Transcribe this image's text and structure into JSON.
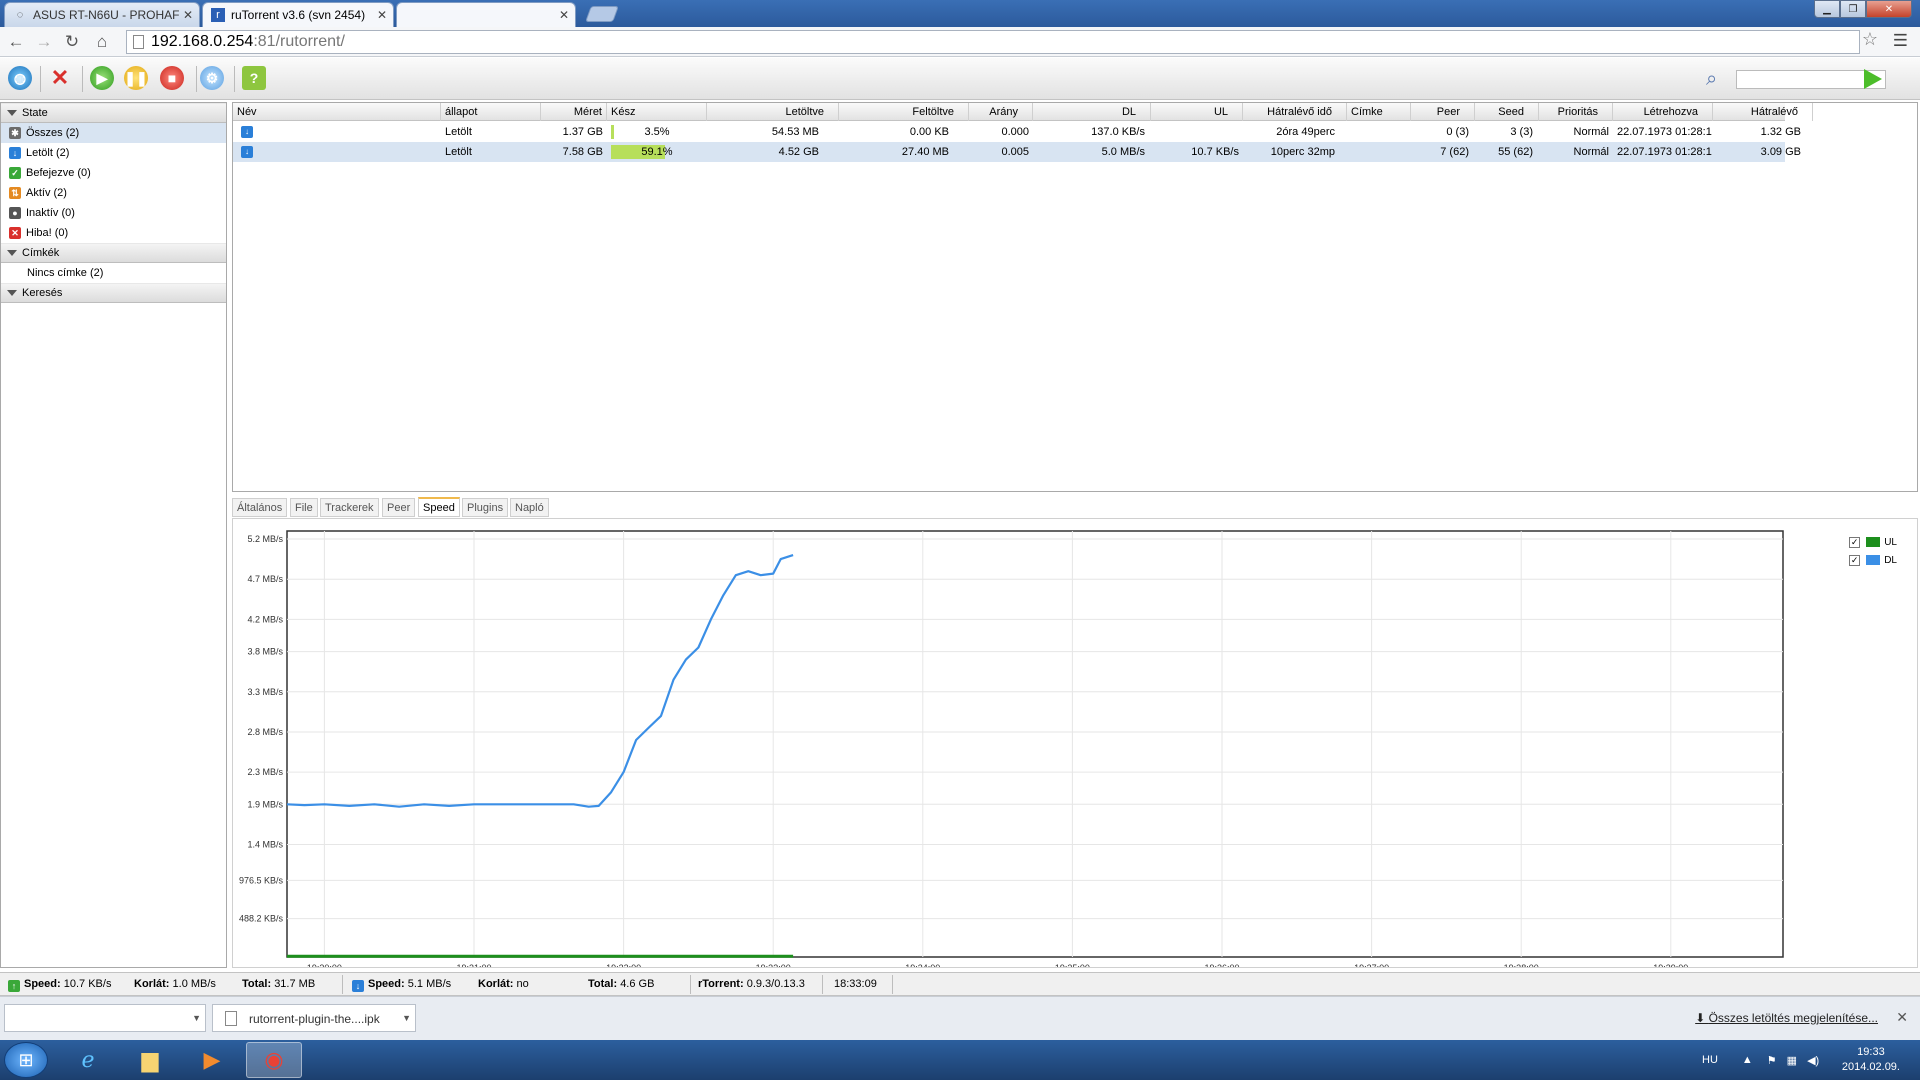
{
  "browser": {
    "tabs": [
      {
        "label": "ASUS RT-N66U - PROHAF",
        "active": false
      },
      {
        "label": "ruTorrent v3.6 (svn 2454)",
        "active": true
      }
    ],
    "url_host": "192.168.0.254",
    "url_rest": ":81/rutorrent/"
  },
  "sidebar": {
    "state_header": "State",
    "state_items": [
      {
        "label": "Összes (2)",
        "icon": "all-icon",
        "color": "#6b6b6b"
      },
      {
        "label": "Letölt (2)",
        "icon": "download-icon",
        "color": "#2a7fd8"
      },
      {
        "label": "Befejezve (0)",
        "icon": "complete-icon",
        "color": "#3aa839"
      },
      {
        "label": "Aktív (2)",
        "icon": "active-icon",
        "color": "#e48a22"
      },
      {
        "label": "Inaktív (0)",
        "icon": "inactive-icon",
        "color": "#555555"
      },
      {
        "label": "Hiba! (0)",
        "icon": "error-icon",
        "color": "#d9302c"
      }
    ],
    "labels_header": "Címkék",
    "labels_items": [
      "Nincs címke (2)"
    ],
    "search_header": "Keresés"
  },
  "torrent_table": {
    "columns": [
      "Név",
      "állapot",
      "Méret",
      "Kész",
      "Letöltve",
      "Feltöltve",
      "Arány",
      "DL",
      "UL",
      "Hátralévő idő",
      "Címke",
      "Peer",
      "Seed",
      "Prioritás",
      "Létrehozva",
      "Hátralévő"
    ],
    "rows": [
      {
        "name": "",
        "status": "Letölt",
        "size": "1.37 GB",
        "done": "3.5%",
        "done_frac": 0.035,
        "downloaded": "54.53 MB",
        "uploaded": "0.00 KB",
        "ratio": "0.000",
        "dl": "137.0 KB/s",
        "ul": "",
        "eta": "2óra 49perc",
        "label": "",
        "peers": "0 (3)",
        "seeds": "3 (3)",
        "priority": "Normál",
        "created": "22.07.1973 01:28:1",
        "remaining": "1.32 GB"
      },
      {
        "name": "",
        "status": "Letölt",
        "size": "7.58 GB",
        "done": "59.1%",
        "done_frac": 0.591,
        "downloaded": "4.52 GB",
        "uploaded": "27.40 MB",
        "ratio": "0.005",
        "dl": "5.0 MB/s",
        "ul": "10.7 KB/s",
        "eta": "10perc 32mp",
        "label": "",
        "peers": "7 (62)",
        "seeds": "55 (62)",
        "priority": "Normál",
        "created": "22.07.1973 01:28:1",
        "remaining": "3.09 GB"
      }
    ]
  },
  "detail_tabs": [
    "Általános",
    "File",
    "Trackerek",
    "Peer",
    "Speed",
    "Plugins",
    "Napló"
  ],
  "active_detail_tab": "Speed",
  "chart_data": {
    "type": "line",
    "y_tick_labels": [
      "5.2 MB/s",
      "4.7 MB/s",
      "4.2 MB/s",
      "3.8 MB/s",
      "3.3 MB/s",
      "2.8 MB/s",
      "2.3 MB/s",
      "1.9 MB/s",
      "1.4 MB/s",
      "976.5 KB/s",
      "488.2 KB/s"
    ],
    "y_tick_values_mbps": [
      5.2,
      4.7,
      4.2,
      3.8,
      3.3,
      2.8,
      2.3,
      1.9,
      1.4,
      0.9537,
      0.4768
    ],
    "ylim_mbps": [
      0,
      5.3
    ],
    "x_tick_labels": [
      "19:30:00",
      "19:31:00",
      "19:32:00",
      "19:33:00",
      "19:34:00",
      "19:35:00",
      "19:36:00",
      "19:37:00",
      "19:38:00",
      "19:39:00"
    ],
    "x_tick_values": [
      "19:30:00",
      "19:31:00",
      "19:32:00",
      "19:33:00",
      "19:34:00",
      "19:35:00",
      "19:36:00",
      "19:37:00",
      "19:38:00",
      "19:39:00"
    ],
    "xlim": [
      "19:29:45",
      "19:39:45"
    ],
    "series": [
      {
        "name": "UL",
        "color": "#1d8f1d",
        "points": [
          [
            "19:29:45",
            0.01
          ],
          [
            "19:31:00",
            0.01
          ],
          [
            "19:32:00",
            0.01
          ],
          [
            "19:33:00",
            0.01
          ],
          [
            "19:33:08",
            0.01
          ]
        ]
      },
      {
        "name": "DL",
        "color": "#3b8fe6",
        "points": [
          [
            "19:29:45",
            1.9
          ],
          [
            "19:29:52",
            1.89
          ],
          [
            "19:30:00",
            1.9
          ],
          [
            "19:30:10",
            1.88
          ],
          [
            "19:30:20",
            1.9
          ],
          [
            "19:30:30",
            1.87
          ],
          [
            "19:30:40",
            1.9
          ],
          [
            "19:30:50",
            1.88
          ],
          [
            "19:31:00",
            1.9
          ],
          [
            "19:31:20",
            1.9
          ],
          [
            "19:31:40",
            1.9
          ],
          [
            "19:31:46",
            1.87
          ],
          [
            "19:31:50",
            1.88
          ],
          [
            "19:31:55",
            2.05
          ],
          [
            "19:32:00",
            2.3
          ],
          [
            "19:32:05",
            2.7
          ],
          [
            "19:32:10",
            2.85
          ],
          [
            "19:32:15",
            3.0
          ],
          [
            "19:32:20",
            3.45
          ],
          [
            "19:32:25",
            3.7
          ],
          [
            "19:32:30",
            3.85
          ],
          [
            "19:32:35",
            4.2
          ],
          [
            "19:32:40",
            4.5
          ],
          [
            "19:32:45",
            4.75
          ],
          [
            "19:32:50",
            4.8
          ],
          [
            "19:32:55",
            4.75
          ],
          [
            "19:33:00",
            4.77
          ],
          [
            "19:33:03",
            4.95
          ],
          [
            "19:33:08",
            5.0
          ]
        ]
      }
    ],
    "legend": [
      {
        "name": "UL",
        "color": "#1d8f1d",
        "checked": true
      },
      {
        "name": "DL",
        "color": "#3b8fe6",
        "checked": true
      }
    ],
    "legend_position": "top-right",
    "grid": true
  },
  "statusbar": {
    "ul_speed_label": "Speed:",
    "ul_speed": "10.7 KB/s",
    "ul_limit_label": "Korlát:",
    "ul_limit": "1.0 MB/s",
    "ul_total_label": "Total:",
    "ul_total": "31.7 MB",
    "dl_speed_label": "Speed:",
    "dl_speed": "5.1 MB/s",
    "dl_limit_label": "Korlát:",
    "dl_limit": "no",
    "dl_total_label": "Total:",
    "dl_total": "4.6 GB",
    "rtorrent_label": "rTorrent:",
    "rtorrent_version": "0.9.3/0.13.3",
    "time": "18:33:09"
  },
  "downloads": {
    "file": "rutorrent-plugin-the....ipk",
    "show_all": "Összes letöltés megjelenítése..."
  },
  "taskbar": {
    "lang": "HU",
    "time": "19:33",
    "date": "2014.02.09."
  }
}
